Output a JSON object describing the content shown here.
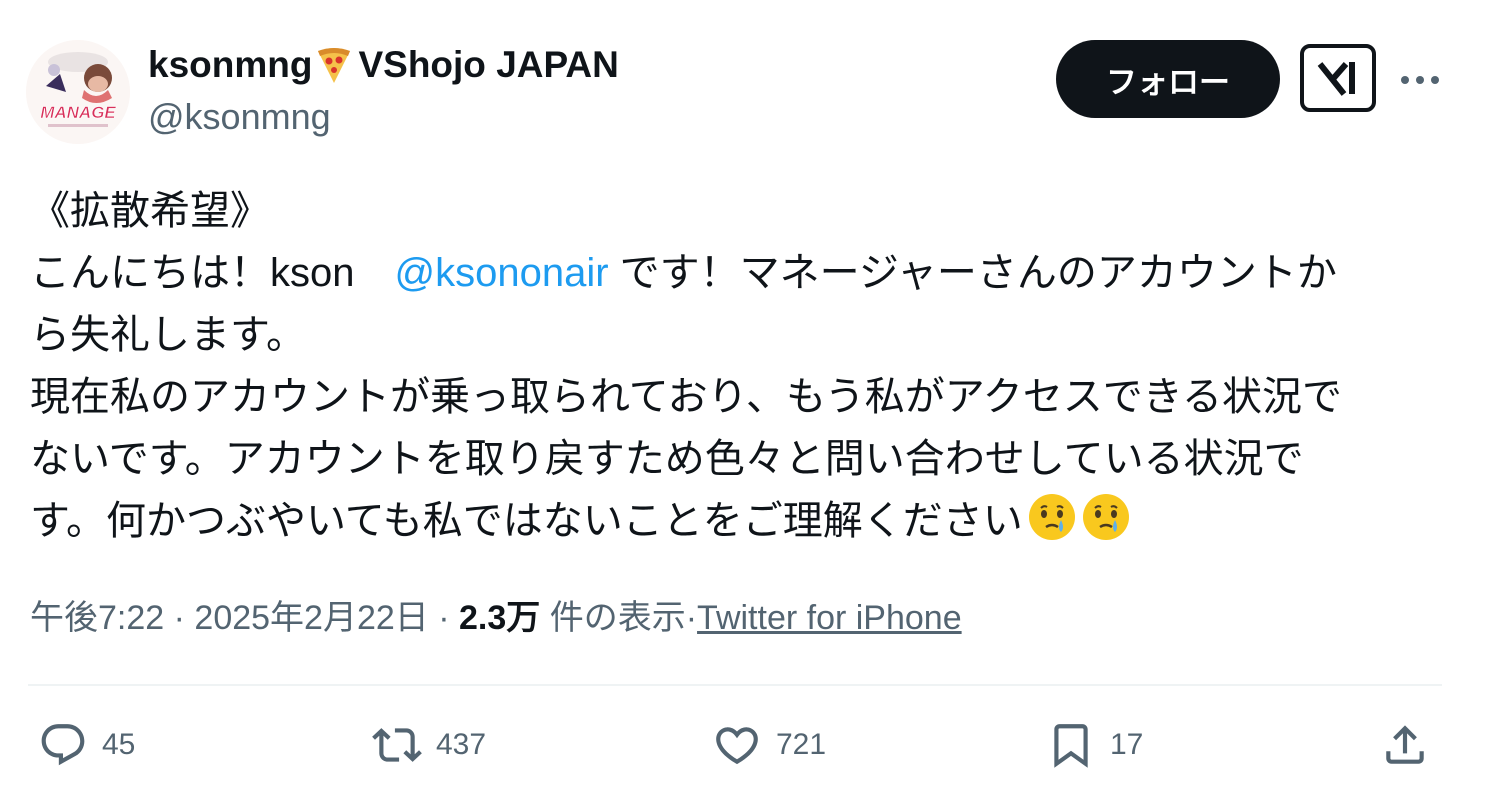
{
  "author": {
    "display_name": "ksonmng",
    "org": "VShojo JAPAN",
    "handle": "@ksonmng",
    "avatar_text": "MANAGE"
  },
  "buttons": {
    "follow": "フォロー"
  },
  "tweet": {
    "lines": [
      "《拡散希望》",
      {
        "pre": "こんにちは！kson　",
        "mention": "@ksononair",
        "post": " です！マネージャーさんのアカウントか"
      },
      "ら失礼します。",
      "現在私のアカウントが乗っ取られており、もう私がアクセスできる状況で",
      "ないです。アカウントを取り戻すため色々と問い合わせしている状況で",
      "す。何かつぶやいても私ではないことをご理解ください"
    ],
    "emoji": [
      "face-holding-back-tears",
      "face-holding-back-tears"
    ]
  },
  "meta": {
    "time": "午後7:22",
    "date": "2025年2月22日",
    "views_count": "2.3万",
    "views_label": "件の表示",
    "source": "Twitter for iPhone"
  },
  "actions": {
    "replies": "45",
    "retweets": "437",
    "likes": "721",
    "bookmarks": "17"
  },
  "colors": {
    "text": "#0f1419",
    "secondary": "#536471",
    "mention": "#1d9bf0",
    "button": "#0f1419"
  },
  "icons": [
    "reply-icon",
    "retweet-icon",
    "like-icon",
    "bookmark-icon",
    "share-icon",
    "grok-icon",
    "more-icon",
    "pizza-icon"
  ]
}
